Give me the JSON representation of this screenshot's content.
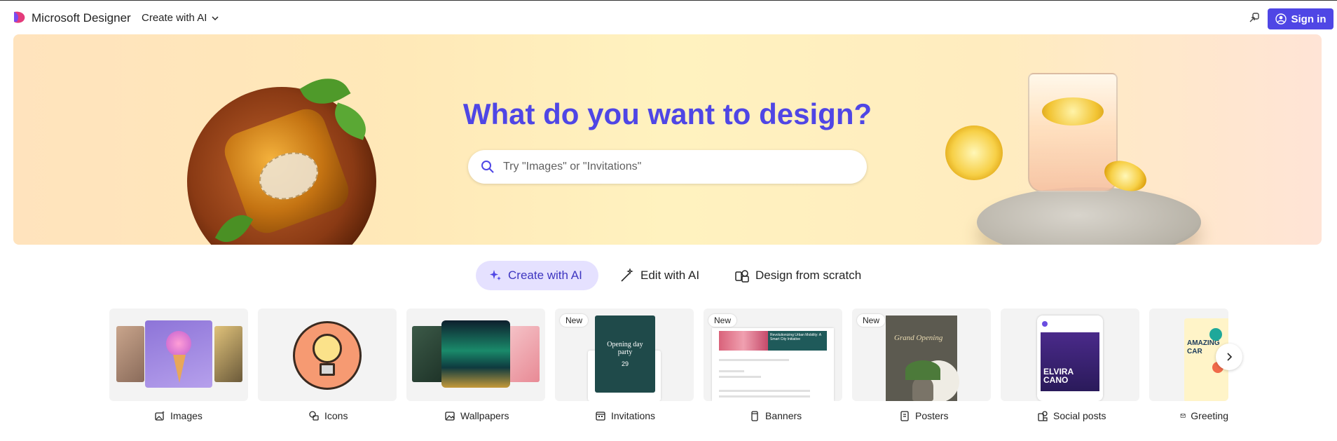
{
  "header": {
    "brand": "Microsoft Designer",
    "create_menu_label": "Create with AI",
    "sign_in_label": "Sign in"
  },
  "hero": {
    "title": "What do you want to design?",
    "search_placeholder": "Try \"Images\" or \"Invitations\""
  },
  "modes": [
    {
      "label": "Create with AI",
      "active": true
    },
    {
      "label": "Edit with AI",
      "active": false
    },
    {
      "label": "Design from scratch",
      "active": false
    }
  ],
  "categories": [
    {
      "label": "Images",
      "badge": ""
    },
    {
      "label": "Icons",
      "badge": ""
    },
    {
      "label": "Wallpapers",
      "badge": ""
    },
    {
      "label": "Invitations",
      "badge": "New"
    },
    {
      "label": "Banners",
      "badge": "New"
    },
    {
      "label": "Posters",
      "badge": "New"
    },
    {
      "label": "Social posts",
      "badge": ""
    },
    {
      "label": "Greeting",
      "badge": ""
    }
  ],
  "thumbnails": {
    "invitation_title": "Opening day party",
    "invitation_date": "29",
    "banner_title": "Revolutionizing Urban Mobility: A Smart City Initiative",
    "poster_title": "Grand Opening",
    "social_name": "ELVIRA CANO",
    "greeting_text": "AMAZING CAR"
  },
  "colors": {
    "accent": "#4f46e5",
    "active_tab_bg": "#e5e1ff"
  }
}
